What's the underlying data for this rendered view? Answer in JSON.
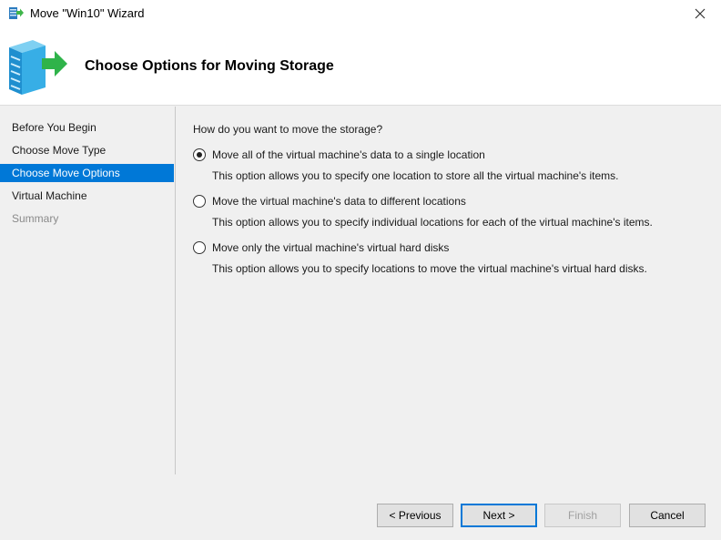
{
  "window": {
    "title": "Move \"Win10\" Wizard",
    "close_glyph": "✕"
  },
  "banner": {
    "heading": "Choose Options for Moving Storage",
    "icon": "storage-move-icon"
  },
  "sidebar": {
    "items": [
      {
        "label": "Before You Begin",
        "state": "normal"
      },
      {
        "label": "Choose Move Type",
        "state": "normal"
      },
      {
        "label": "Choose Move Options",
        "state": "active"
      },
      {
        "label": "Virtual Machine",
        "state": "normal"
      },
      {
        "label": "Summary",
        "state": "disabled"
      }
    ]
  },
  "content": {
    "question": "How do you want to move the storage?",
    "options": [
      {
        "label": "Move all of the virtual machine's data to a single location",
        "description": "This option allows you to specify one location to store all the virtual machine's items.",
        "selected": true
      },
      {
        "label": "Move the virtual machine's data to different locations",
        "description": "This option allows you to specify individual locations for each of the virtual machine's items.",
        "selected": false
      },
      {
        "label": "Move only the virtual machine's virtual hard disks",
        "description": "This option allows you to specify locations to move the virtual machine's virtual hard disks.",
        "selected": false
      }
    ]
  },
  "footer": {
    "previous_label": "< Previous",
    "next_label": "Next >",
    "finish_label": "Finish",
    "cancel_label": "Cancel"
  },
  "colors": {
    "accent": "#0078d7",
    "panel_bg": "#f0f0f0",
    "header_bg": "#ffffff"
  }
}
